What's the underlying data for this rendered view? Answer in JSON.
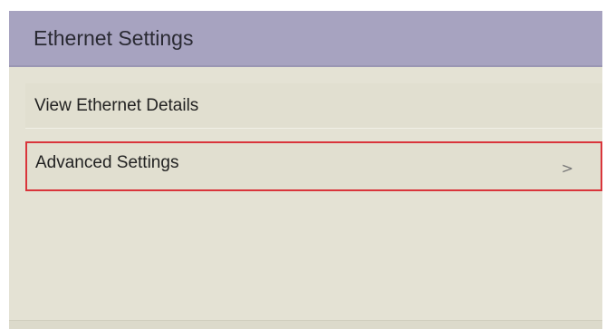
{
  "header": {
    "title": "Ethernet Settings"
  },
  "menu": {
    "items": [
      {
        "label": "View Ethernet Details"
      },
      {
        "label": "Advanced Settings",
        "chevron": ">",
        "selected": true
      }
    ]
  },
  "colors": {
    "header_bg": "#a7a3c0",
    "content_bg": "#e4e2d4",
    "selection_border": "#d9353b"
  }
}
